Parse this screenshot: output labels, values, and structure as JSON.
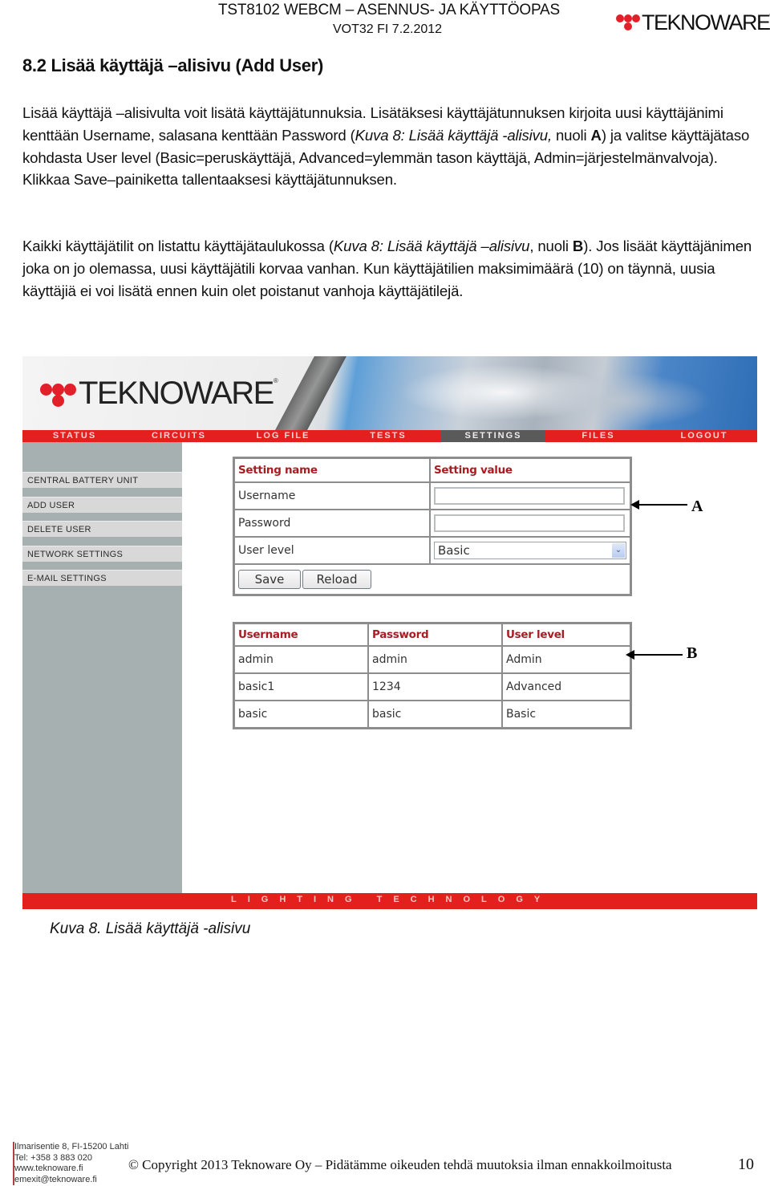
{
  "document": {
    "header_title": "TST8102 WEBCM – ASENNUS- JA KÄYTTÖOPAS",
    "header_version": "VOT32 FI 7.2.2012",
    "brand": "TEKNOWARE",
    "brand_reg": "®",
    "section_title": "8.2 Lisää käyttäjä –alisivu (Add User)",
    "paragraph1": {
      "p1": "Lisää käyttäjä –alisivulta voit lisätä käyttäjätunnuksia. Lisätäksesi käyttäjätunnuksen kirjoita uusi käyttäjänimi kenttään Username, salasana kenttään Password (",
      "p1_italic": "Kuva 8: Lisää käyttäjä -alisivu,",
      "p1_b": " nuoli ",
      "p1_bold": "A",
      "p1_end": ") ja valitse käyttäjätaso kohdasta User level (Basic=peruskäyttäjä, Advanced=ylemmän tason käyttäjä, Admin=järjestelmänvalvoja). Klikkaa Save–painiketta tallentaaksesi käyttäjätunnuksen."
    },
    "paragraph2": {
      "p1": "Kaikki käyttäjätilit on listattu käyttäjätaulukossa (",
      "p1_italic": "Kuva 8: Lisää käyttäjä –alisivu",
      "p1_b": ", nuoli ",
      "p1_bold": "B",
      "p1_end": "). Jos lisäät käyttäjänimen joka on jo olemassa, uusi käyttäjätili korvaa vanhan. Kun käyttäjätilien maksimimäärä (10) on täynnä, uusia käyttäjiä ei voi lisätä ennen kuin olet poistanut vanhoja käyttäjätilejä."
    },
    "caption": "Kuva 8.  Lisää käyttäjä -alisivu",
    "arrow_a_label": "A",
    "arrow_b_label": "B",
    "footer": {
      "address": [
        "Ilmarisentie 8, FI-15200 Lahti",
        "Tel: +358 3 883 020",
        "www.teknoware.fi",
        "emexit@teknoware.fi"
      ],
      "copyright": "© Copyright 2013 Teknoware Oy – Pidätämme oikeuden tehdä muutoksia ilman ennakkoilmoitusta",
      "page_number": "10"
    }
  },
  "webui": {
    "brand": "TEKNOWARE",
    "brand_reg": "®",
    "nav": [
      {
        "label": "STATUS",
        "active": false
      },
      {
        "label": "CIRCUITS",
        "active": false
      },
      {
        "label": "LOG FILE",
        "active": false
      },
      {
        "label": "TESTS",
        "active": false
      },
      {
        "label": "SETTINGS",
        "active": true
      },
      {
        "label": "FILES",
        "active": false
      },
      {
        "label": "LOGOUT",
        "active": false
      }
    ],
    "sidebar": [
      {
        "label": "CENTRAL BATTERY UNIT"
      },
      {
        "label": "ADD USER"
      },
      {
        "label": "DELETE USER"
      },
      {
        "label": "NETWORK SETTINGS"
      },
      {
        "label": "E-MAIL SETTINGS"
      }
    ],
    "form": {
      "header_name": "Setting name",
      "header_value": "Setting value",
      "username_label": "Username",
      "username_value": "",
      "password_label": "Password",
      "password_value": "",
      "userlevel_label": "User level",
      "userlevel_value": "Basic",
      "save_label": "Save",
      "reload_label": "Reload"
    },
    "users_table": {
      "headers": [
        "Username",
        "Password",
        "User level"
      ],
      "rows": [
        [
          "admin",
          "admin",
          "Admin"
        ],
        [
          "basic1",
          "1234",
          "Advanced"
        ],
        [
          "basic",
          "basic",
          "Basic"
        ]
      ]
    },
    "footer_tagline": "LIGHTING TECHNOLOGY",
    "colors": {
      "accent_red": "#e4201f",
      "header_red": "#a81c22",
      "active_tab": "#5a5a5a",
      "sidebar_gray": "#a6b0b1"
    }
  }
}
